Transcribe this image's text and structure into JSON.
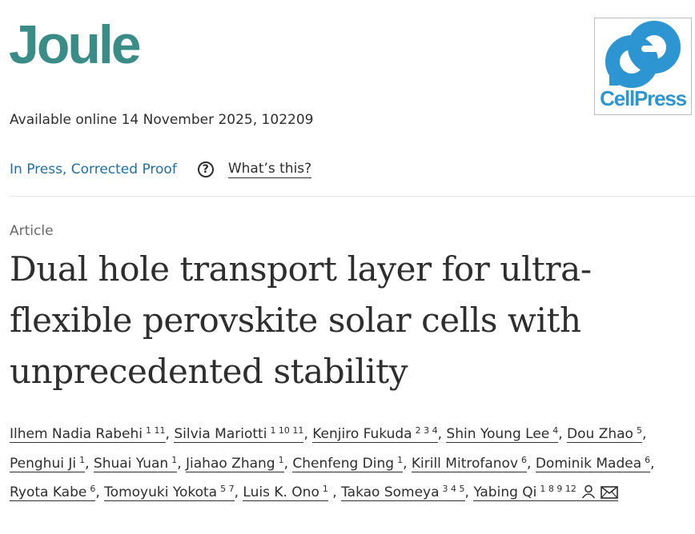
{
  "header": {
    "journal_name": "Joule",
    "publisher_logo_text": "CellPress",
    "publisher_logo_color": "#2e95d3",
    "journal_color": "#3a8c86"
  },
  "meta": {
    "available": "Available online 14 November 2025, 102209",
    "status_link": "In Press, Corrected Proof",
    "help_icon": "question-circle-icon",
    "whats_this": "What’s this?"
  },
  "article": {
    "type": "Article",
    "title": "Dual hole transport layer for ultra-flexible perovskite solar cells with unprecedented stability"
  },
  "authors": [
    {
      "name": "Ilhem Nadia Rabehi",
      "aff": "1 11"
    },
    {
      "name": "Silvia Mariotti",
      "aff": "1 10 11"
    },
    {
      "name": "Kenjiro Fukuda",
      "aff": "2 3 4"
    },
    {
      "name": "Shin Young Lee",
      "aff": "4"
    },
    {
      "name": "Dou Zhao",
      "aff": "5"
    },
    {
      "name": "Penghui Ji",
      "aff": "1"
    },
    {
      "name": "Shuai Yuan",
      "aff": "1"
    },
    {
      "name": "Jiahao Zhang",
      "aff": "1"
    },
    {
      "name": "Chenfeng Ding",
      "aff": "1"
    },
    {
      "name": "Kirill Mitrofanov",
      "aff": "6"
    },
    {
      "name": "Dominik Madea",
      "aff": "6"
    },
    {
      "name": "Ryota Kabe",
      "aff": "6"
    },
    {
      "name": "Tomoyuki Yokota",
      "aff": "5 7"
    },
    {
      "name": "Luis K. Ono",
      "aff": "1"
    },
    {
      "name": "Takao Someya",
      "aff": "3 4 5"
    },
    {
      "name": "Yabing Qi",
      "aff": "1 8 9 12"
    }
  ],
  "corresponding_icons": [
    "person-icon",
    "envelope-icon"
  ]
}
